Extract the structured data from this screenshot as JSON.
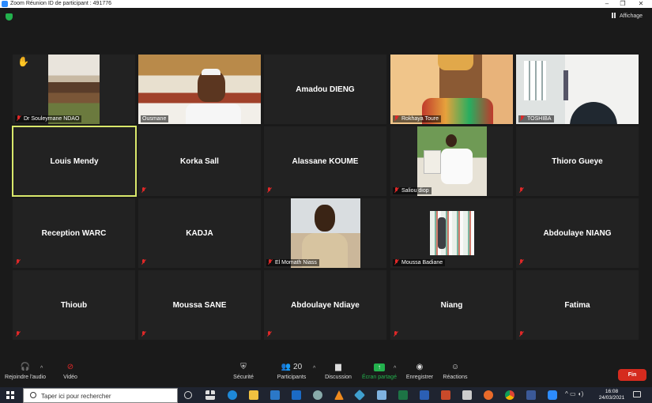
{
  "window": {
    "title": "Zoom Réunion ID de participant : 491776"
  },
  "topbar": {
    "view_label": "Affichage"
  },
  "tiles": [
    {
      "name": "Dr Souleymane NDAO",
      "raised_hand": true
    },
    {
      "name": "Ousmane"
    },
    {
      "name": "Amadou DIENG"
    },
    {
      "name": "Rokhaya Toure"
    },
    {
      "name": "TOSHIBA"
    },
    {
      "name": "Louis Mendy",
      "active_speaker": true
    },
    {
      "name": "Korka Sall"
    },
    {
      "name": "Alassane KOUME"
    },
    {
      "name": "Saliou diop"
    },
    {
      "name": "Thioro Gueye"
    },
    {
      "name": "Reception WARC"
    },
    {
      "name": "KADJA"
    },
    {
      "name": "El Momath Niass"
    },
    {
      "name": "Moussa Badiane"
    },
    {
      "name": "Abdoulaye NIANG"
    },
    {
      "name": "Thioub"
    },
    {
      "name": "Moussa SANE"
    },
    {
      "name": "Abdoulaye Ndiaye"
    },
    {
      "name": "Niang"
    },
    {
      "name": "Fatima"
    }
  ],
  "controls": {
    "audio": "Rejoindre l'audio",
    "video": "Vidéo",
    "security": "Sécurité",
    "participants": "Participants",
    "participants_count": "20",
    "chat": "Discussion",
    "share": "Écran partagé",
    "record": "Enregistrer",
    "reactions": "Réactions",
    "end": "Fin"
  },
  "taskbar": {
    "search_placeholder": "Taper ici pour rechercher",
    "time": "16:08",
    "date": "24/03/2021"
  },
  "colors": {
    "active_speaker_border": "#d9e86b",
    "share_green": "#23b14d",
    "end_red": "#d52b1e"
  }
}
